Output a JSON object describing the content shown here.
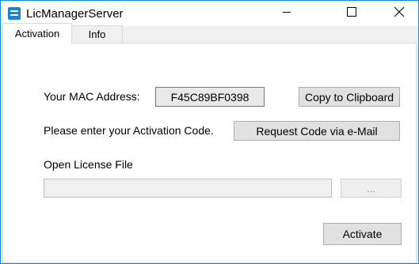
{
  "window": {
    "title": "LicManagerServer",
    "accent_color": "#1883d7",
    "controls": {
      "minimize_icon": "minimize-icon",
      "maximize_icon": "maximize-icon",
      "close_icon": "close-icon"
    }
  },
  "tabs": [
    {
      "label": "Activation",
      "selected": true
    },
    {
      "label": "Info",
      "selected": false
    }
  ],
  "activation": {
    "mac_label": "Your MAC Address:",
    "mac_value": "F45C89BF0398",
    "copy_button": "Copy to Clipboard",
    "code_prompt": "Please enter your Activation Code.",
    "request_button": "Request Code via e-Mail",
    "license_label": "Open License File",
    "license_path": "",
    "browse_button": "...",
    "activate_button": "Activate"
  }
}
